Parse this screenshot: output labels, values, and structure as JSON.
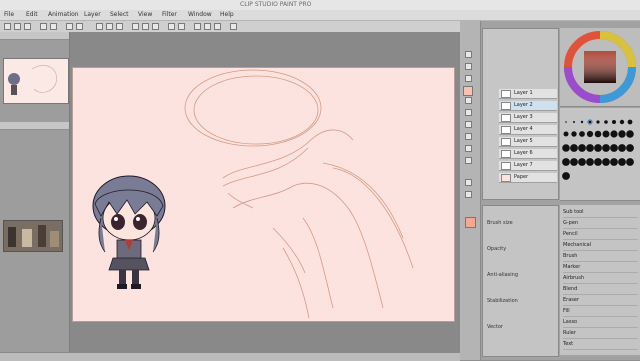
{
  "window": {
    "title": "CLIP STUDIO PAINT PRO"
  },
  "menu": [
    "File",
    "Edit",
    "Animation",
    "Layer",
    "Select",
    "View",
    "Filter",
    "Window",
    "Help"
  ],
  "layers": {
    "rows": [
      {
        "name": "Layer 1"
      },
      {
        "name": "Layer 2"
      },
      {
        "name": "Layer 3"
      },
      {
        "name": "Layer 4"
      },
      {
        "name": "Layer 5"
      },
      {
        "name": "Layer 6"
      },
      {
        "name": "Layer 7"
      },
      {
        "name": "Paper"
      }
    ]
  },
  "properties": {
    "rows": [
      "Brush size",
      "Opacity",
      "Anti-aliasing",
      "Stabilization",
      "Vector"
    ]
  },
  "subtools": {
    "rows": [
      "Sub tool",
      "G-pen",
      "Pencil",
      "Mechanical",
      "Brush",
      "Marker",
      "Airbrush",
      "Blend",
      "Eraser",
      "Fill",
      "Lasso",
      "Ruler",
      "Text"
    ]
  },
  "colors": {
    "main": "#f7a894",
    "sub": "#f9c1b4",
    "canvas": "#fde3df"
  }
}
